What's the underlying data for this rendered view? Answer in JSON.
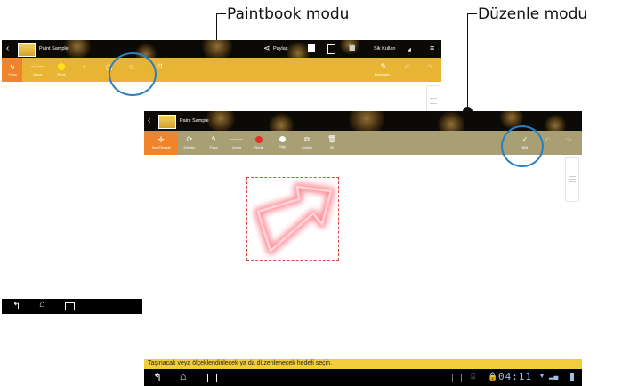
{
  "callouts": {
    "paintbook": "Paintbook modu",
    "edit": "Düzenle modu"
  },
  "paintbook": {
    "title": "Paint Sample",
    "actions": {
      "share": "Paylaş",
      "user": "Sik Kullan"
    },
    "tools": {
      "brush": "Fırça",
      "stroke": "Vuruş",
      "color": "Renk",
      "edit": "Düzenleh..."
    }
  },
  "editmode": {
    "title": "Paint Sample",
    "tools": {
      "move": "Taşı/Ölçekle",
      "rotate": "Döndür",
      "brush": "Fırça",
      "stroke": "Vuruş",
      "color": "Renk",
      "erase": "Silgi",
      "duplicate": "Çoğalt",
      "delete": "Sil",
      "done": "Bitti"
    },
    "status_message": "Taşınacak veya ölçeklendirilecek ya da düzenlenecek hedefi seçin.",
    "clock": "04:11"
  },
  "colors": {
    "toolbar_yellow": "#e8b433",
    "toolbar_orange": "#f0842a",
    "toolbar_olive": "#a8a074",
    "status_yellow": "#f1cd3c",
    "highlight_circle": "#2a7fc4",
    "selection_dash": "#e0463c",
    "color_dot_red": "#e0302a",
    "color_dot_yellow": "#ffe31a"
  }
}
